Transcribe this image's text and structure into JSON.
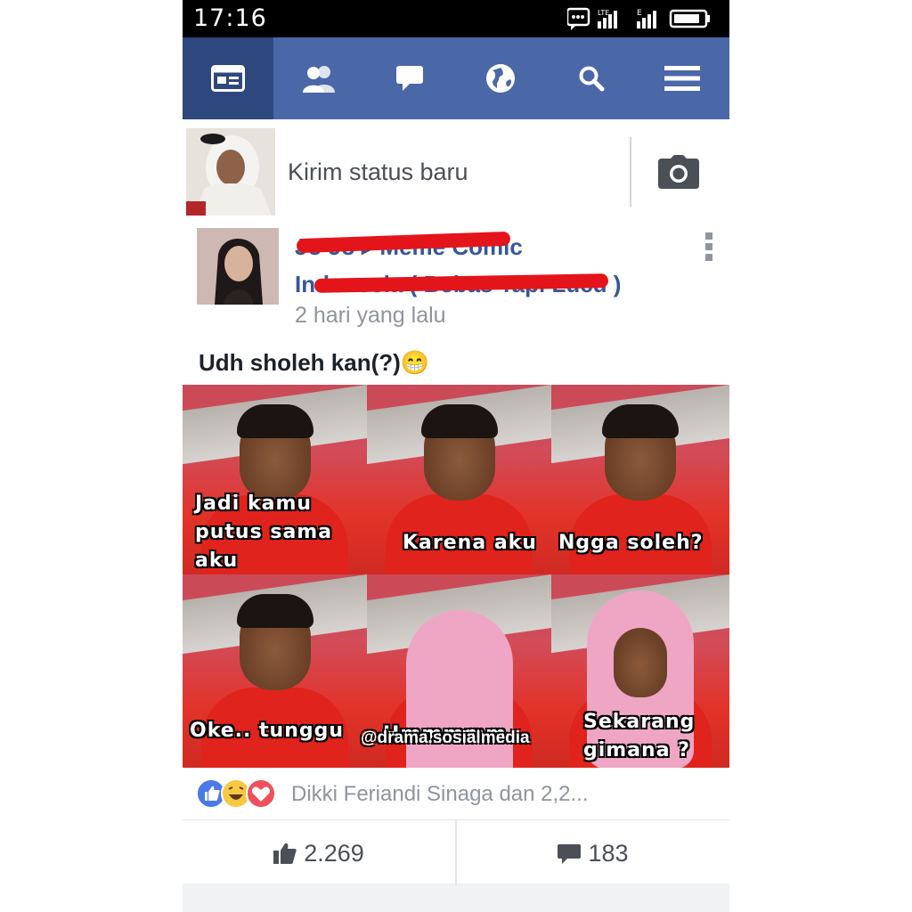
{
  "status_bar": {
    "time": "17:16"
  },
  "nav": {
    "tabs": [
      "news-feed",
      "friends",
      "messages",
      "notifications",
      "search",
      "menu"
    ],
    "active": "news-feed",
    "colors": {
      "bar": "#4a67a8",
      "active": "#2e477d"
    }
  },
  "composer": {
    "placeholder": "Kirim status baru"
  },
  "post": {
    "author_line1": "Jo Jo ▸ Meme Comic",
    "author_line2": "Indonesia ( Bebas Tapi Lucu )",
    "time": "2 hari yang lalu",
    "caption": "Udh sholeh kan(?)😁",
    "panels": [
      {
        "text": "Jadi kamu\nputus sama\naku"
      },
      {
        "text": "Karena aku"
      },
      {
        "text": "Ngga soleh?"
      },
      {
        "text": "Oke.. tunggu"
      },
      {
        "text": "Hmmmmm.."
      },
      {
        "text": "Sekarang\ngimana ?"
      }
    ],
    "watermark": "@drama.sosialmedia",
    "reactions_text": "Dikki Feriandi Sinaga dan 2,2...",
    "likes": "2.269",
    "comments": "183"
  }
}
